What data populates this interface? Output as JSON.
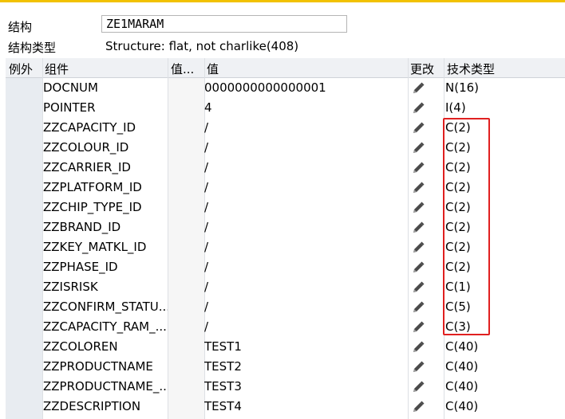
{
  "header": {
    "structure_label": "结构",
    "structure_value": "ZE1MARAM",
    "type_label": "结构类型",
    "type_value": "Structure: flat, not charlike(408)"
  },
  "columns": {
    "exception": "例外",
    "component": "组件",
    "value_short": "值...",
    "value": "值",
    "change": "更改",
    "tech_type": "技术类型"
  },
  "rows": [
    {
      "component": "DOCNUM",
      "value": "0000000000000001",
      "type": "N(16)"
    },
    {
      "component": "POINTER",
      "value": "4",
      "type": "I(4)"
    },
    {
      "component": "ZZCAPACITY_ID",
      "value": "/",
      "type": "C(2)"
    },
    {
      "component": "ZZCOLOUR_ID",
      "value": "/",
      "type": "C(2)"
    },
    {
      "component": "ZZCARRIER_ID",
      "value": "/",
      "type": "C(2)"
    },
    {
      "component": "ZZPLATFORM_ID",
      "value": "/",
      "type": "C(2)"
    },
    {
      "component": "ZZCHIP_TYPE_ID",
      "value": "/",
      "type": "C(2)"
    },
    {
      "component": "ZZBRAND_ID",
      "value": "/",
      "type": "C(2)"
    },
    {
      "component": "ZZKEY_MATKL_ID",
      "value": "/",
      "type": "C(2)"
    },
    {
      "component": "ZZPHASE_ID",
      "value": "/",
      "type": "C(2)"
    },
    {
      "component": "ZZISRISK",
      "value": "/",
      "type": "C(1)"
    },
    {
      "component": "ZZCONFIRM_STATU...",
      "value": "/",
      "type": "C(5)"
    },
    {
      "component": "ZZCAPACITY_RAM_...",
      "value": "/",
      "type": "C(3)"
    },
    {
      "component": "ZZCOLOREN",
      "value": "TEST1",
      "type": "C(40)"
    },
    {
      "component": "ZZPRODUCTNAME",
      "value": "TEST2",
      "type": "C(40)"
    },
    {
      "component": "ZZPRODUCTNAME_...",
      "value": "TEST3",
      "type": "C(40)"
    },
    {
      "component": "ZZDESCRIPTION",
      "value": "TEST4",
      "type": "C(40)"
    }
  ],
  "icons": {
    "edit": "pencil-icon"
  },
  "colors": {
    "highlight": "#e02020",
    "accent": "#f2c200"
  }
}
